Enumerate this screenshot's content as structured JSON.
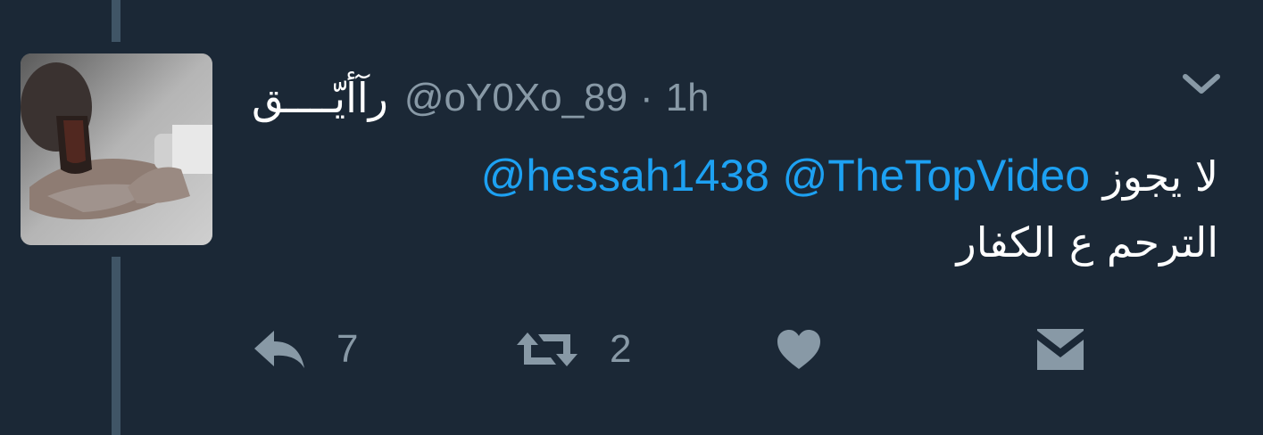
{
  "tweet": {
    "display_name": "رآأيّــــق",
    "handle": "@oY0Xo_89",
    "separator": "·",
    "time": "1h",
    "text_prefix": "لا يجوز",
    "mentions": [
      "@TheTopVideo",
      "@hessah1438"
    ],
    "text_suffix": "الترحم ع الكفار"
  },
  "actions": {
    "reply_count": "7",
    "retweet_count": "2",
    "icons": [
      "reply-icon",
      "retweet-icon",
      "like-icon",
      "direct-message-icon"
    ]
  },
  "colors": {
    "background": "#1b2836",
    "text": "#ffffff",
    "muted": "#8899a6",
    "link": "#1da1f2",
    "thread_line": "#405566"
  }
}
